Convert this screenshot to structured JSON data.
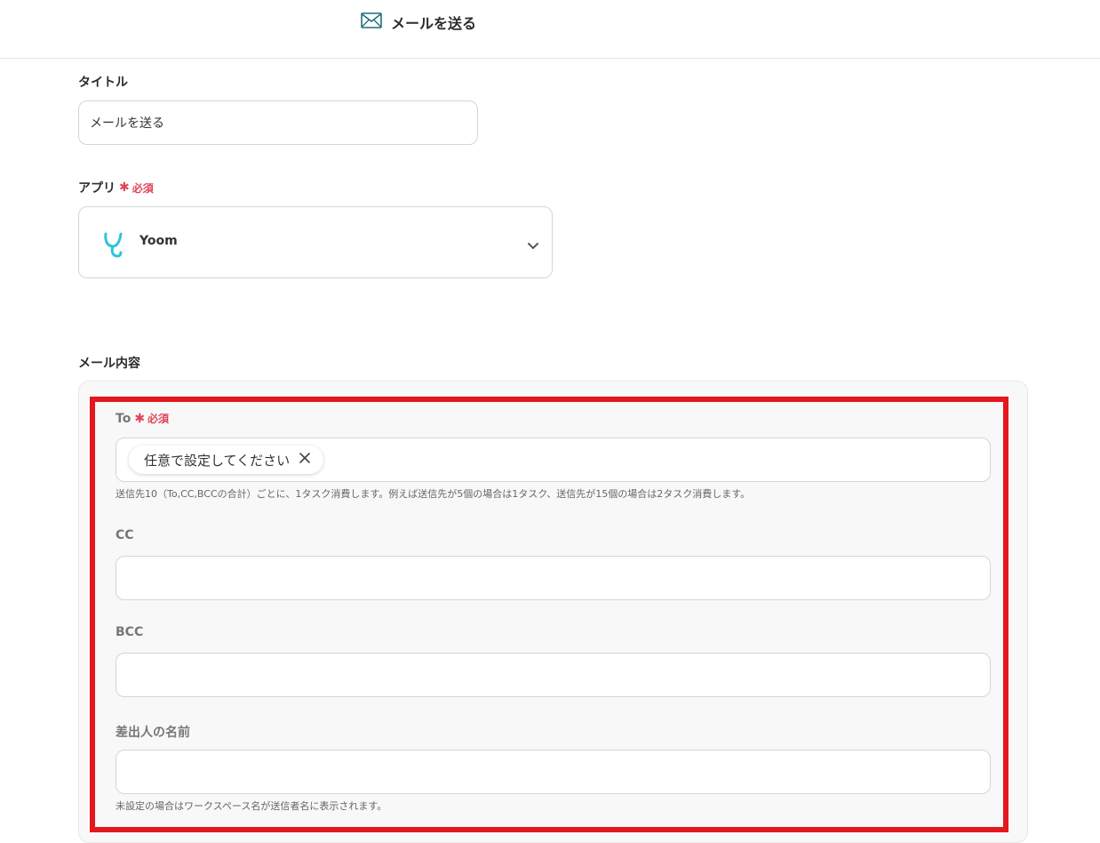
{
  "header": {
    "icon": "mail-icon",
    "title": "メールを送る"
  },
  "title_field": {
    "label": "タイトル",
    "value": "メールを送る"
  },
  "app_field": {
    "label": "アプリ",
    "required": "必須",
    "selected_app": "Yoom",
    "logo_icon": "yoom-logo-icon",
    "brand_color": "#2ec4d6"
  },
  "mail": {
    "section_label": "メール内容",
    "to": {
      "label": "To",
      "required": "必須",
      "chip_text": "任意で設定してください",
      "hint": "送信先10（To,CC,BCCの合計）ごとに、1タスク消費します。例えば送信先が5個の場合は1タスク、送信先が15個の場合は2タスク消費します。"
    },
    "cc": {
      "label": "CC",
      "value": ""
    },
    "bcc": {
      "label": "BCC",
      "value": ""
    },
    "sender_name": {
      "label": "差出人の名前",
      "value": "",
      "hint": "未設定の場合はワークスペース名が送信者名に表示されます。"
    }
  },
  "colors": {
    "required": "#e0445a",
    "highlight": "#e3171d"
  }
}
